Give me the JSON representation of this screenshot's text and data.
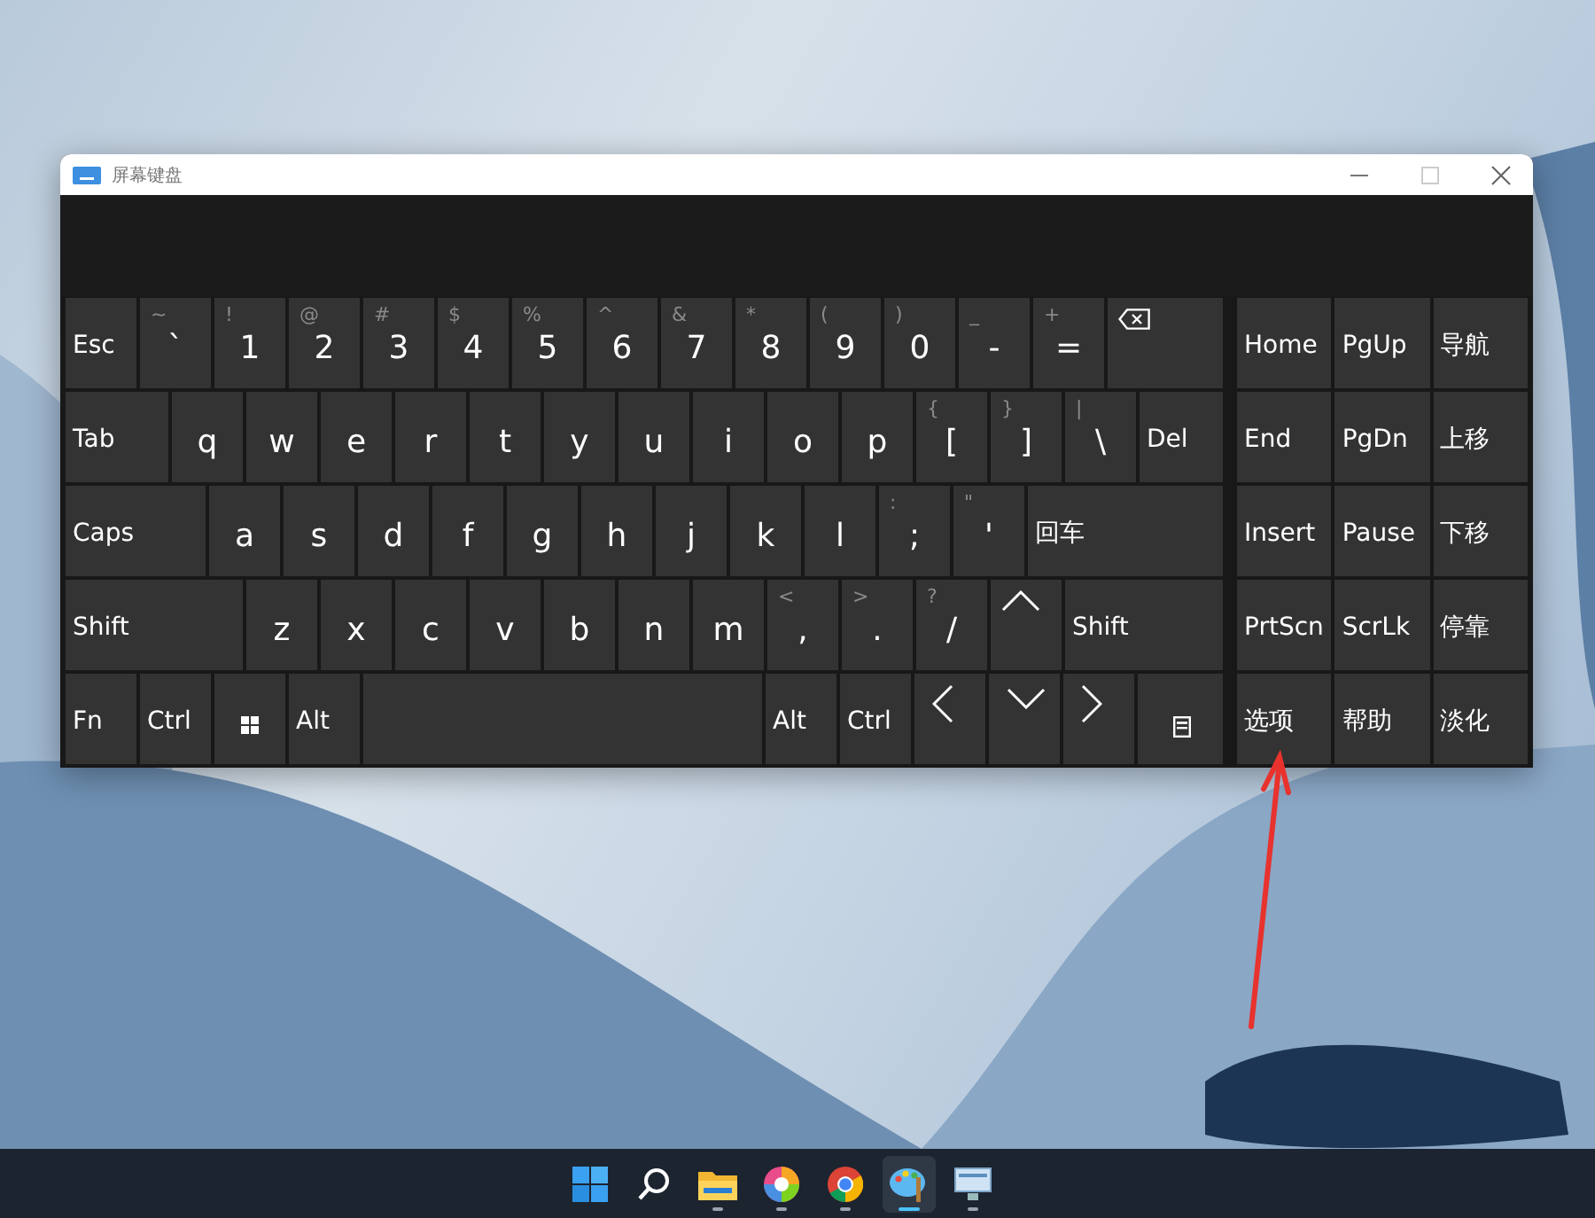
{
  "window": {
    "title": "屏幕键盘"
  },
  "keyboard": {
    "rows": [
      [
        {
          "kind": "label",
          "label": "Esc"
        },
        {
          "kind": "char",
          "label": "`",
          "shift": "~"
        },
        {
          "kind": "char",
          "label": "1",
          "shift": "!"
        },
        {
          "kind": "char",
          "label": "2",
          "shift": "@"
        },
        {
          "kind": "char",
          "label": "3",
          "shift": "#"
        },
        {
          "kind": "char",
          "label": "4",
          "shift": "$"
        },
        {
          "kind": "char",
          "label": "5",
          "shift": "%"
        },
        {
          "kind": "char",
          "label": "6",
          "shift": "^"
        },
        {
          "kind": "char",
          "label": "7",
          "shift": "&"
        },
        {
          "kind": "char",
          "label": "8",
          "shift": "*"
        },
        {
          "kind": "char",
          "label": "9",
          "shift": "("
        },
        {
          "kind": "char",
          "label": "0",
          "shift": ")"
        },
        {
          "kind": "char",
          "label": "-",
          "shift": "_"
        },
        {
          "kind": "char",
          "label": "=",
          "shift": "+"
        },
        {
          "kind": "backspace"
        }
      ],
      [
        {
          "kind": "label",
          "label": "Tab"
        },
        {
          "kind": "char",
          "label": "q"
        },
        {
          "kind": "char",
          "label": "w"
        },
        {
          "kind": "char",
          "label": "e"
        },
        {
          "kind": "char",
          "label": "r"
        },
        {
          "kind": "char",
          "label": "t"
        },
        {
          "kind": "char",
          "label": "y"
        },
        {
          "kind": "char",
          "label": "u"
        },
        {
          "kind": "char",
          "label": "i"
        },
        {
          "kind": "char",
          "label": "o"
        },
        {
          "kind": "char",
          "label": "p"
        },
        {
          "kind": "char",
          "label": "[",
          "shift": "{"
        },
        {
          "kind": "char",
          "label": "]",
          "shift": "}"
        },
        {
          "kind": "char",
          "label": "\\",
          "shift": "|"
        },
        {
          "kind": "label",
          "label": "Del"
        }
      ],
      [
        {
          "kind": "label",
          "label": "Caps"
        },
        {
          "kind": "char",
          "label": "a"
        },
        {
          "kind": "char",
          "label": "s"
        },
        {
          "kind": "char",
          "label": "d"
        },
        {
          "kind": "char",
          "label": "f"
        },
        {
          "kind": "char",
          "label": "g"
        },
        {
          "kind": "char",
          "label": "h"
        },
        {
          "kind": "char",
          "label": "j"
        },
        {
          "kind": "char",
          "label": "k"
        },
        {
          "kind": "char",
          "label": "l"
        },
        {
          "kind": "char",
          "label": ";",
          "shift": ":"
        },
        {
          "kind": "char",
          "label": "'",
          "shift": "\""
        },
        {
          "kind": "label",
          "label": "回车"
        }
      ],
      [
        {
          "kind": "label",
          "label": "Shift"
        },
        {
          "kind": "char",
          "label": "z"
        },
        {
          "kind": "char",
          "label": "x"
        },
        {
          "kind": "char",
          "label": "c"
        },
        {
          "kind": "char",
          "label": "v"
        },
        {
          "kind": "char",
          "label": "b"
        },
        {
          "kind": "char",
          "label": "n"
        },
        {
          "kind": "char",
          "label": "m"
        },
        {
          "kind": "char",
          "label": ",",
          "shift": "<"
        },
        {
          "kind": "char",
          "label": ".",
          "shift": ">"
        },
        {
          "kind": "char",
          "label": "/",
          "shift": "?"
        },
        {
          "kind": "up"
        },
        {
          "kind": "label",
          "label": "Shift"
        }
      ],
      [
        {
          "kind": "label",
          "label": "Fn"
        },
        {
          "kind": "label",
          "label": "Ctrl"
        },
        {
          "kind": "windows"
        },
        {
          "kind": "label",
          "label": "Alt"
        },
        {
          "kind": "space"
        },
        {
          "kind": "label",
          "label": "Alt"
        },
        {
          "kind": "label",
          "label": "Ctrl"
        },
        {
          "kind": "left"
        },
        {
          "kind": "down"
        },
        {
          "kind": "right"
        },
        {
          "kind": "menu"
        }
      ]
    ],
    "nav": [
      [
        {
          "kind": "label",
          "label": "Home"
        },
        {
          "kind": "label",
          "label": "PgUp"
        },
        {
          "kind": "label",
          "label": "导航"
        }
      ],
      [
        {
          "kind": "label",
          "label": "End"
        },
        {
          "kind": "label",
          "label": "PgDn"
        },
        {
          "kind": "label",
          "label": "上移"
        }
      ],
      [
        {
          "kind": "label",
          "label": "Insert"
        },
        {
          "kind": "label",
          "label": "Pause"
        },
        {
          "kind": "label",
          "label": "下移"
        }
      ],
      [
        {
          "kind": "label",
          "label": "PrtScn"
        },
        {
          "kind": "label",
          "label": "ScrLk"
        },
        {
          "kind": "label",
          "label": "停靠"
        }
      ],
      [
        {
          "kind": "label",
          "label": "选项"
        },
        {
          "kind": "label",
          "label": "帮助"
        },
        {
          "kind": "label",
          "label": "淡化"
        }
      ]
    ]
  },
  "taskbar": {
    "apps": [
      {
        "kind": "start",
        "running": false,
        "selected": false
      },
      {
        "kind": "search",
        "running": false,
        "selected": false
      },
      {
        "kind": "folder",
        "running": true,
        "selected": false
      },
      {
        "kind": "pinwheel",
        "running": true,
        "selected": false
      },
      {
        "kind": "browser",
        "running": true,
        "selected": false
      },
      {
        "kind": "palette",
        "running": true,
        "selected": true
      },
      {
        "kind": "monitor",
        "running": true,
        "selected": false
      }
    ]
  }
}
